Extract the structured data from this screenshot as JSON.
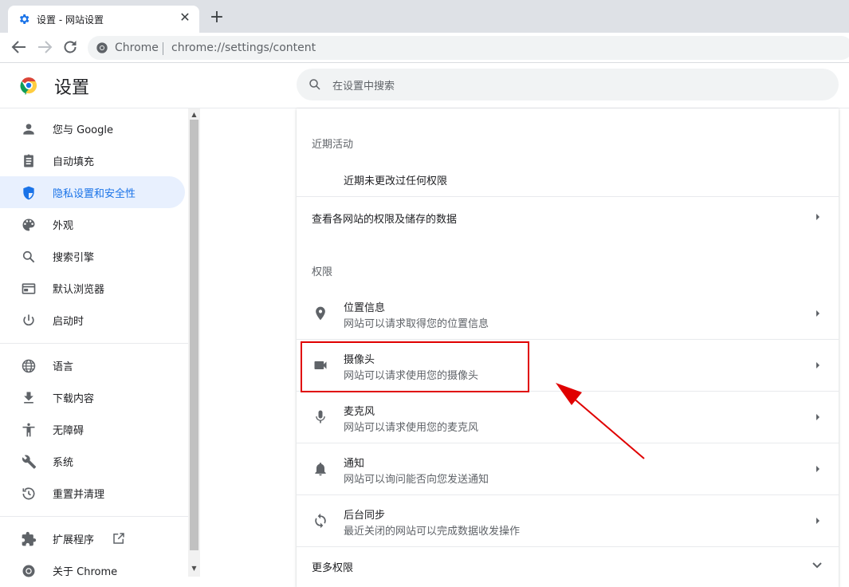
{
  "tab": {
    "title": "设置 - 网站设置",
    "close": "✕",
    "new_tab": "+"
  },
  "omnibox": {
    "site": "Chrome",
    "url": "chrome://settings/content"
  },
  "header": {
    "title": "设置",
    "search_placeholder": "在设置中搜索"
  },
  "sidebar": {
    "items": [
      {
        "label": "您与 Google",
        "icon": "person-icon"
      },
      {
        "label": "自动填充",
        "icon": "clipboard-icon"
      },
      {
        "label": "隐私设置和安全性",
        "icon": "shield-icon",
        "active": true
      },
      {
        "label": "外观",
        "icon": "palette-icon"
      },
      {
        "label": "搜索引擎",
        "icon": "search-icon"
      },
      {
        "label": "默认浏览器",
        "icon": "browser-icon"
      },
      {
        "label": "启动时",
        "icon": "power-icon"
      },
      {
        "label": "语言",
        "icon": "globe-icon"
      },
      {
        "label": "下载内容",
        "icon": "download-icon"
      },
      {
        "label": "无障碍",
        "icon": "accessibility-icon"
      },
      {
        "label": "系统",
        "icon": "wrench-icon"
      },
      {
        "label": "重置并清理",
        "icon": "history-icon"
      },
      {
        "label": "扩展程序",
        "icon": "puzzle-icon"
      },
      {
        "label": "关于 Chrome",
        "icon": "chrome-icon"
      }
    ]
  },
  "content": {
    "recent_heading": "近期活动",
    "recent_empty": "近期未更改过任何权限",
    "view_all": "查看各网站的权限及储存的数据",
    "permissions_heading": "权限",
    "permissions": [
      {
        "title": "位置信息",
        "sub": "网站可以请求取得您的位置信息",
        "icon": "location-icon"
      },
      {
        "title": "摄像头",
        "sub": "网站可以请求使用您的摄像头",
        "icon": "camera-icon"
      },
      {
        "title": "麦克风",
        "sub": "网站可以请求使用您的麦克风",
        "icon": "microphone-icon"
      },
      {
        "title": "通知",
        "sub": "网站可以询问能否向您发送通知",
        "icon": "bell-icon"
      },
      {
        "title": "后台同步",
        "sub": "最近关闭的网站可以完成数据收发操作",
        "icon": "sync-icon"
      }
    ],
    "more_permissions": "更多权限"
  },
  "colors": {
    "accent": "#1a73e8",
    "active_bg": "#e8f0fe",
    "annotation": "#e00000"
  }
}
